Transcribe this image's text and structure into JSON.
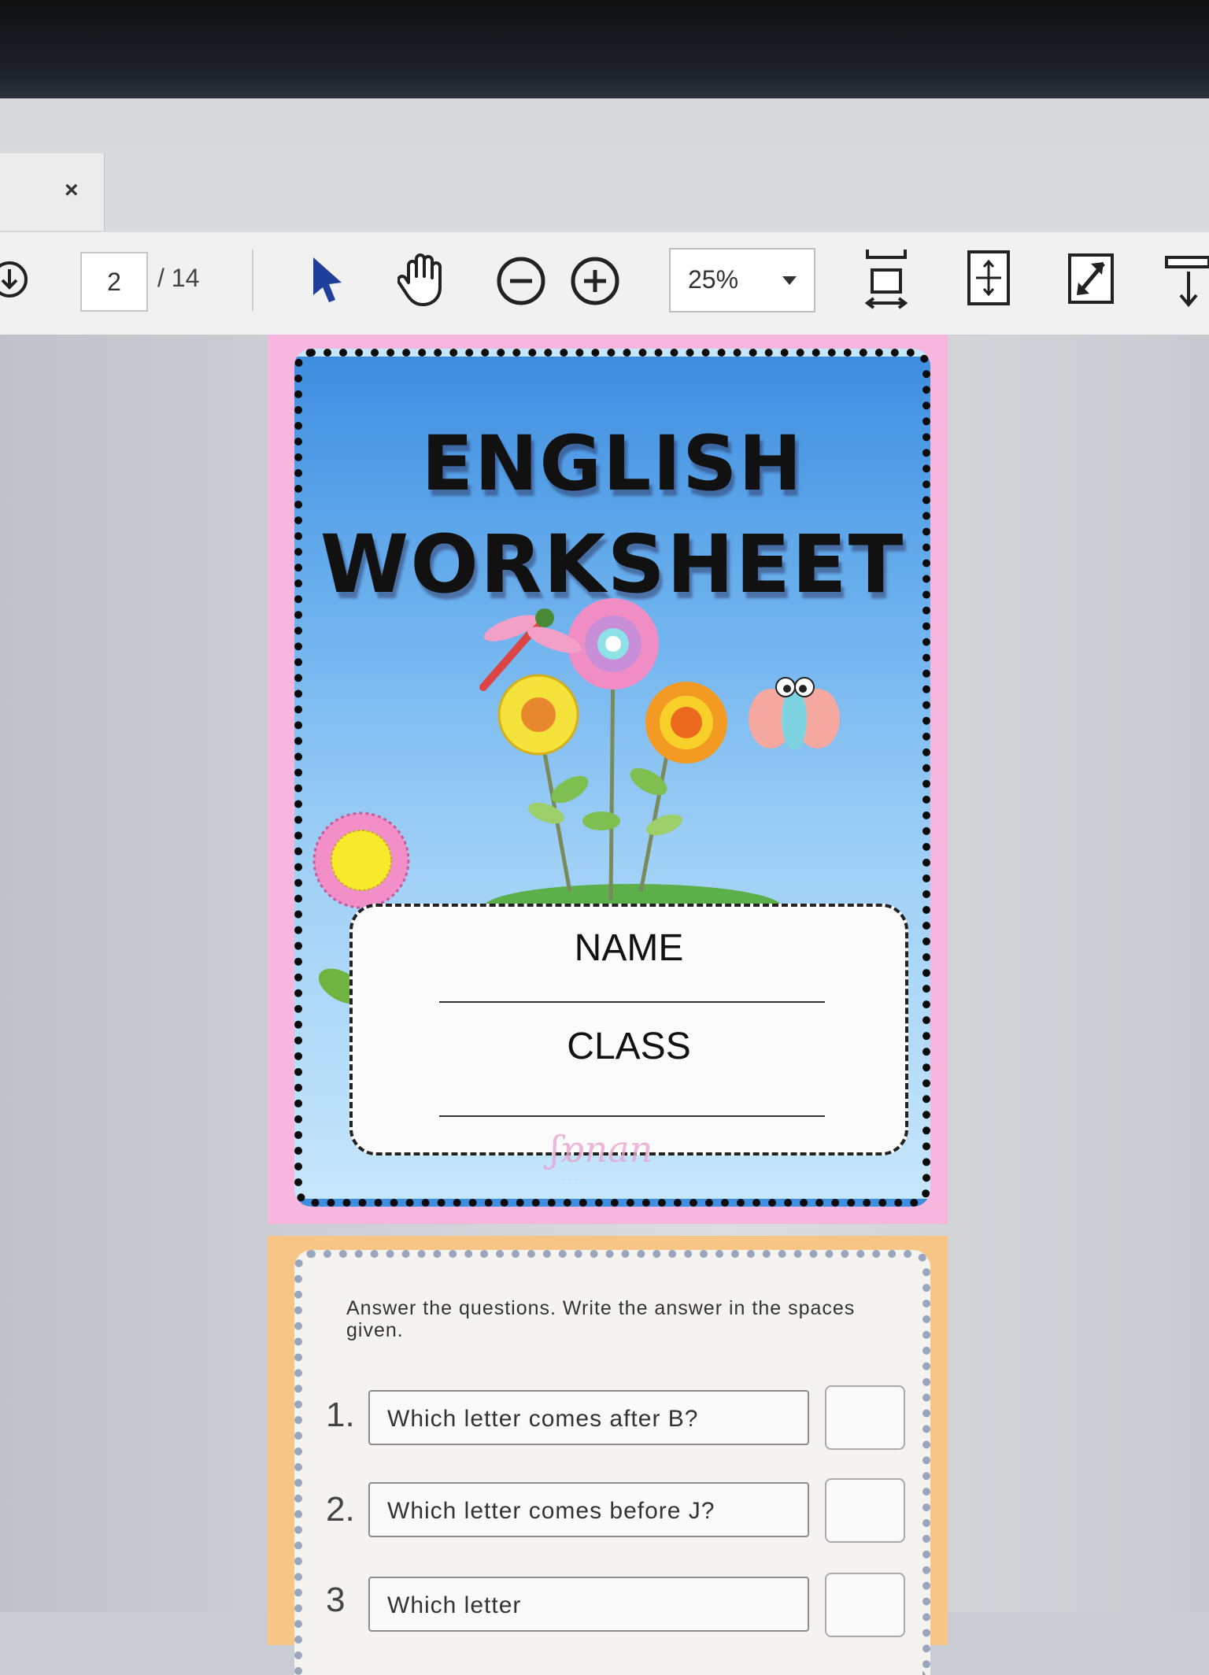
{
  "window": {
    "tab_close": "×"
  },
  "toolbar": {
    "current_page": "2",
    "total_pages": "/ 14",
    "zoom": "25%",
    "icons": [
      "download-icon",
      "select-pointer-icon",
      "hand-tool-icon",
      "zoom-out-icon",
      "zoom-in-icon",
      "fit-width-icon",
      "fit-page-icon",
      "fullscreen-icon",
      "scroll-mode-icon"
    ]
  },
  "page1": {
    "title_line1": "ENGLISH",
    "title_line2": "WORKSHEET",
    "name_label": "NAME",
    "class_label": "CLASS",
    "accent_pink": "#f6b6de",
    "sky_blue": "#6cb1ee"
  },
  "page2": {
    "instructions": "Answer the questions. Write the answer in the spaces given.",
    "questions": [
      {
        "num": "1.",
        "text": "Which letter comes after B?"
      },
      {
        "num": "2.",
        "text": "Which letter comes before J?"
      },
      {
        "num": "3",
        "text": "Which letter"
      }
    ],
    "accent_orange": "#f7c585"
  }
}
